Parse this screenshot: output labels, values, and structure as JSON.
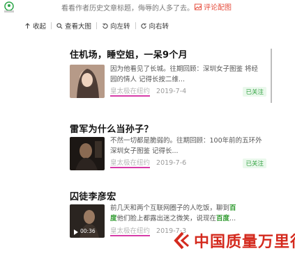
{
  "topbar": {
    "text": "看看作者历史文章标题，侮辱的人多了去。",
    "map_button": "评论配图",
    "map_icon": "image-icon"
  },
  "toolbar": {
    "items": [
      {
        "label": "收起",
        "icon": "arrow-up-icon"
      },
      {
        "label": "查看大图",
        "icon": "search-icon"
      },
      {
        "label": "向左转",
        "icon": "rotate-left-icon"
      },
      {
        "label": "向右转",
        "icon": "rotate-right-icon"
      }
    ]
  },
  "articles": [
    {
      "title": "住机场，睡空姐，一呆9个月",
      "summary_parts": [
        "因为他看见了长城。往期回顾：深圳女子图鉴 将经园的情人 记得长按二维..."
      ],
      "author": "皇太极在纽约",
      "date": "2019-7-4",
      "follow": "已关注"
    },
    {
      "title": "雷军为什么当孙子？",
      "summary_parts": [
        "不然一切都是脆弱的。往期回顾：100年前的五环外 深圳女子图鉴 记得长..."
      ],
      "author": "皇太极在纽约",
      "date": "2019-7-6",
      "follow": "已关注"
    },
    {
      "title": "囚徒李彦宏",
      "summary_a": "前几天和两个互联网圈子的人吃饭，聊到",
      "summary_hl1": "百",
      "summary_b": "度",
      "summary_c": "他们脸上都露出迷之微笑，说现在",
      "summary_hl2": "百度",
      "summary_d": "...",
      "author": "皇太极在纽约",
      "date": "2019-7-3",
      "video_duration": "00:36"
    }
  ],
  "watermark": {
    "text": "中国质量万里行"
  },
  "colors": {
    "accent_red": "#d42a1e",
    "follow_green": "#2e9f3d",
    "underline_magenta": "#d63ca8"
  }
}
